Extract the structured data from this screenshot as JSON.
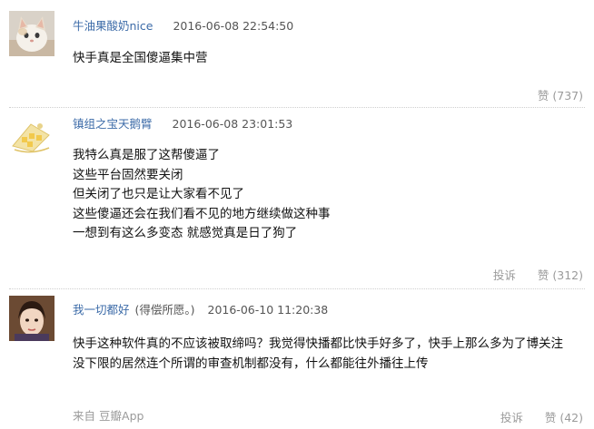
{
  "comments": [
    {
      "username": "牛油果酸奶nice",
      "note": "",
      "timestamp": "2016-06-08 22:54:50",
      "avatar": "cat-avatar",
      "lines": [
        "快手真是全国傻逼集中营"
      ],
      "report_label": "",
      "like_label": "赞",
      "like_count": "(737)",
      "source_prefix": "",
      "source_app": ""
    },
    {
      "username": "镇组之宝天鹅臂",
      "note": "",
      "timestamp": "2016-06-08 23:01:53",
      "avatar": "illustration-avatar",
      "lines": [
        "我特么真是服了这帮傻逼了",
        "这些平台固然要关闭",
        "但关闭了也只是让大家看不见了",
        "这些傻逼还会在我们看不见的地方继续做这种事",
        "一想到有这么多变态 就感觉真是日了狗了"
      ],
      "report_label": "投诉",
      "like_label": "赞",
      "like_count": "(312)",
      "source_prefix": "",
      "source_app": ""
    },
    {
      "username": "我一切都好",
      "note": "(得偿所愿。)",
      "timestamp": "2016-06-10 11:20:38",
      "avatar": "portrait-avatar",
      "lines": [
        "快手这种软件真的不应该被取缔吗？我觉得快播都比快手好多了，快手上那么多为了博关注",
        "没下限的居然连个所谓的审查机制都没有，什么都能往外播往上传"
      ],
      "report_label": "投诉",
      "like_label": "赞",
      "like_count": "(42)",
      "source_prefix": "来自",
      "source_app": "豆瓣App"
    }
  ]
}
